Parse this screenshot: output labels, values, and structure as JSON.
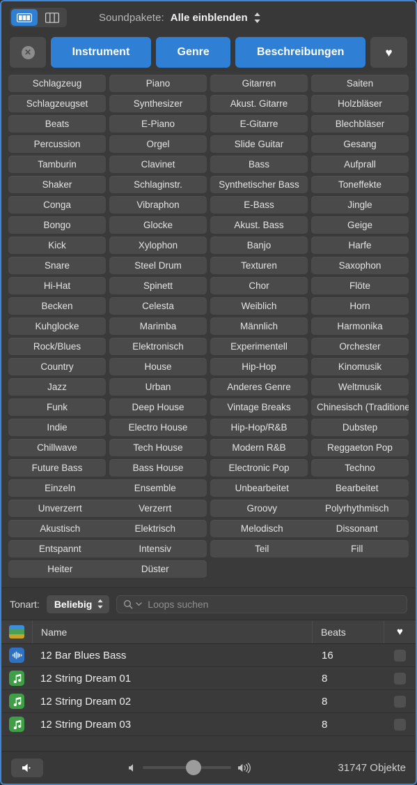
{
  "window": {
    "accent_color": "#3e87d8"
  },
  "toolbar": {
    "view_toggle": [
      {
        "name": "columns-filled-view",
        "active": true
      },
      {
        "name": "columns-outline-view",
        "active": false
      }
    ],
    "soundpacks_label": "Soundpakete:",
    "soundpacks_value": "Alle einblenden"
  },
  "tabs": {
    "clear_label": "✕",
    "items": [
      {
        "label": "Instrument",
        "selected": true
      },
      {
        "label": "Genre",
        "selected": true
      },
      {
        "label": "Beschreibungen",
        "selected": true
      }
    ],
    "favorites_icon": "heart-icon"
  },
  "keyword_grid": {
    "rows": [
      {
        "type": "narrow",
        "cells": [
          "Schlagzeug",
          "Piano",
          "Gitarren",
          "Saiten"
        ]
      },
      {
        "type": "narrow",
        "cells": [
          "Schlagzeugset",
          "Synthesizer",
          "Akust. Gitarre",
          "Holzbläser"
        ]
      },
      {
        "type": "narrow",
        "cells": [
          "Beats",
          "E-Piano",
          "E-Gitarre",
          "Blechbläser"
        ]
      },
      {
        "type": "narrow",
        "cells": [
          "Percussion",
          "Orgel",
          "Slide Guitar",
          "Gesang"
        ]
      },
      {
        "type": "narrow",
        "cells": [
          "Tamburin",
          "Clavinet",
          "Bass",
          "Aufprall"
        ]
      },
      {
        "type": "narrow",
        "cells": [
          "Shaker",
          "Schlaginstr.",
          "Synthetischer Bass",
          "Toneffekte"
        ]
      },
      {
        "type": "narrow",
        "cells": [
          "Conga",
          "Vibraphon",
          "E-Bass",
          "Jingle"
        ]
      },
      {
        "type": "narrow",
        "cells": [
          "Bongo",
          "Glocke",
          "Akust. Bass",
          "Geige"
        ]
      },
      {
        "type": "narrow",
        "cells": [
          "Kick",
          "Xylophon",
          "Banjo",
          "Harfe"
        ]
      },
      {
        "type": "narrow",
        "cells": [
          "Snare",
          "Steel Drum",
          "Texturen",
          "Saxophon"
        ]
      },
      {
        "type": "narrow",
        "cells": [
          "Hi-Hat",
          "Spinett",
          "Chor",
          "Flöte"
        ]
      },
      {
        "type": "narrow",
        "cells": [
          "Becken",
          "Celesta",
          "Weiblich",
          "Horn"
        ]
      },
      {
        "type": "narrow",
        "cells": [
          "Kuhglocke",
          "Marimba",
          "Männlich",
          "Harmonika"
        ]
      },
      {
        "type": "narrow",
        "cells": [
          "Rock/Blues",
          "Elektronisch",
          "Experimentell",
          "Orchester"
        ]
      },
      {
        "type": "narrow",
        "cells": [
          "Country",
          "House",
          "Hip-Hop",
          "Kinomusik"
        ]
      },
      {
        "type": "narrow",
        "cells": [
          "Jazz",
          "Urban",
          "Anderes Genre",
          "Weltmusik"
        ]
      },
      {
        "type": "narrow",
        "cells": [
          "Funk",
          "Deep House",
          "Vintage Breaks",
          "Chinesisch (Traditionell)"
        ]
      },
      {
        "type": "narrow",
        "cells": [
          "Indie",
          "Electro House",
          "Hip-Hop/R&B",
          "Dubstep"
        ]
      },
      {
        "type": "narrow",
        "cells": [
          "Chillwave",
          "Tech House",
          "Modern R&B",
          "Reggaeton Pop"
        ]
      },
      {
        "type": "narrow",
        "cells": [
          "Future Bass",
          "Bass House",
          "Electronic Pop",
          "Techno"
        ]
      },
      {
        "type": "wide",
        "cells": [
          [
            "Einzeln",
            "Ensemble"
          ],
          [
            "Unbearbeitet",
            "Bearbeitet"
          ]
        ]
      },
      {
        "type": "wide",
        "cells": [
          [
            "Unverzerrt",
            "Verzerrt"
          ],
          [
            "Groovy",
            "Polyrhythmisch"
          ]
        ]
      },
      {
        "type": "wide",
        "cells": [
          [
            "Akustisch",
            "Elektrisch"
          ],
          [
            "Melodisch",
            "Dissonant"
          ]
        ]
      },
      {
        "type": "wide",
        "cells": [
          [
            "Entspannt",
            "Intensiv"
          ],
          [
            "Teil",
            "Fill"
          ]
        ]
      },
      {
        "type": "wide",
        "cells": [
          [
            "Heiter",
            "Düster"
          ],
          null
        ]
      }
    ]
  },
  "search": {
    "key_label": "Tonart:",
    "key_value": "Beliebig",
    "placeholder": "Loops suchen",
    "value": ""
  },
  "results": {
    "columns": {
      "name": "Name",
      "beats": "Beats",
      "favorite": "♥"
    },
    "rows": [
      {
        "name": "12 Bar Blues Bass",
        "beats": "16",
        "icon": "audio-wave-icon",
        "icon_color": "#2f72c4",
        "favorite": false
      },
      {
        "name": "12 String Dream 01",
        "beats": "8",
        "icon": "music-note-icon",
        "icon_color": "#3f9e46",
        "favorite": false
      },
      {
        "name": "12 String Dream 02",
        "beats": "8",
        "icon": "music-note-icon",
        "icon_color": "#3f9e46",
        "favorite": false
      },
      {
        "name": "12 String Dream 03",
        "beats": "8",
        "icon": "music-note-icon",
        "icon_color": "#3f9e46",
        "favorite": false
      }
    ]
  },
  "footer": {
    "speaker_icon": "speaker-icon",
    "volume_min_icon": "speaker-low-icon",
    "volume_max_icon": "speaker-high-icon",
    "volume_percent": 58,
    "count_label": "31747 Objekte"
  }
}
